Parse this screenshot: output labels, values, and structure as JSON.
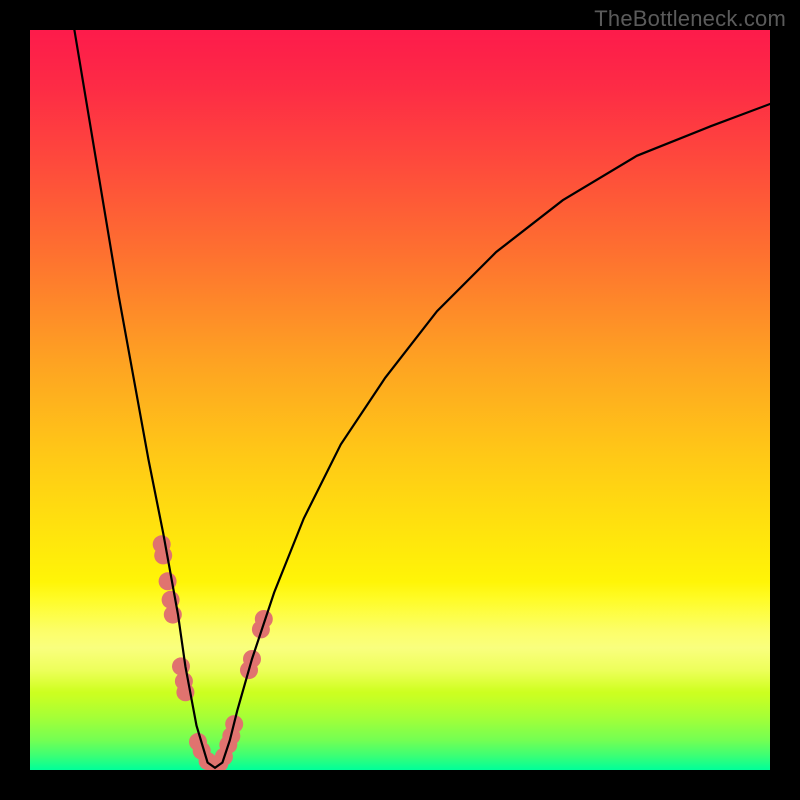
{
  "watermark": {
    "text": "TheBottleneck.com"
  },
  "chart_data": {
    "type": "line",
    "title": "",
    "xlabel": "",
    "ylabel": "",
    "xlim": [
      0,
      100
    ],
    "ylim": [
      0,
      100
    ],
    "grid": false,
    "legend": false,
    "background_gradient": {
      "stops": [
        {
          "pos": 0.0,
          "color": "#fd1b4b"
        },
        {
          "pos": 0.18,
          "color": "#fe4a3c"
        },
        {
          "pos": 0.45,
          "color": "#fea322"
        },
        {
          "pos": 0.77,
          "color": "#fffb05"
        },
        {
          "pos": 0.93,
          "color": "#a3ff38"
        },
        {
          "pos": 1.0,
          "color": "#00ff9a"
        }
      ]
    },
    "series": [
      {
        "name": "bottleneck-curve",
        "x": [
          6,
          8,
          10,
          12,
          14,
          16,
          18,
          20,
          21,
          22.5,
          24,
          25,
          26,
          27,
          28,
          30,
          33,
          37,
          42,
          48,
          55,
          63,
          72,
          82,
          92,
          100
        ],
        "y": [
          100,
          88,
          76,
          64,
          53,
          42,
          32,
          21,
          14,
          6,
          1,
          0.3,
          1,
          4,
          8,
          15,
          24,
          34,
          44,
          53,
          62,
          70,
          77,
          83,
          87,
          90
        ]
      }
    ],
    "markers": [
      {
        "x": 17.8,
        "y": 30.5
      },
      {
        "x": 18.0,
        "y": 29.0
      },
      {
        "x": 18.6,
        "y": 25.5
      },
      {
        "x": 19.0,
        "y": 23.0
      },
      {
        "x": 19.3,
        "y": 21.0
      },
      {
        "x": 20.4,
        "y": 14.0
      },
      {
        "x": 20.8,
        "y": 12.0
      },
      {
        "x": 21.0,
        "y": 10.5
      },
      {
        "x": 22.7,
        "y": 3.8
      },
      {
        "x": 23.2,
        "y": 2.6
      },
      {
        "x": 24.0,
        "y": 1.2
      },
      {
        "x": 24.8,
        "y": 0.6
      },
      {
        "x": 25.6,
        "y": 0.9
      },
      {
        "x": 26.2,
        "y": 1.8
      },
      {
        "x": 26.8,
        "y": 3.4
      },
      {
        "x": 27.2,
        "y": 4.6
      },
      {
        "x": 27.6,
        "y": 6.2
      },
      {
        "x": 29.6,
        "y": 13.5
      },
      {
        "x": 30.0,
        "y": 15.0
      },
      {
        "x": 31.2,
        "y": 19.0
      },
      {
        "x": 31.6,
        "y": 20.4
      }
    ],
    "marker_style": {
      "color": "#e0736f",
      "radius_px": 9
    }
  }
}
